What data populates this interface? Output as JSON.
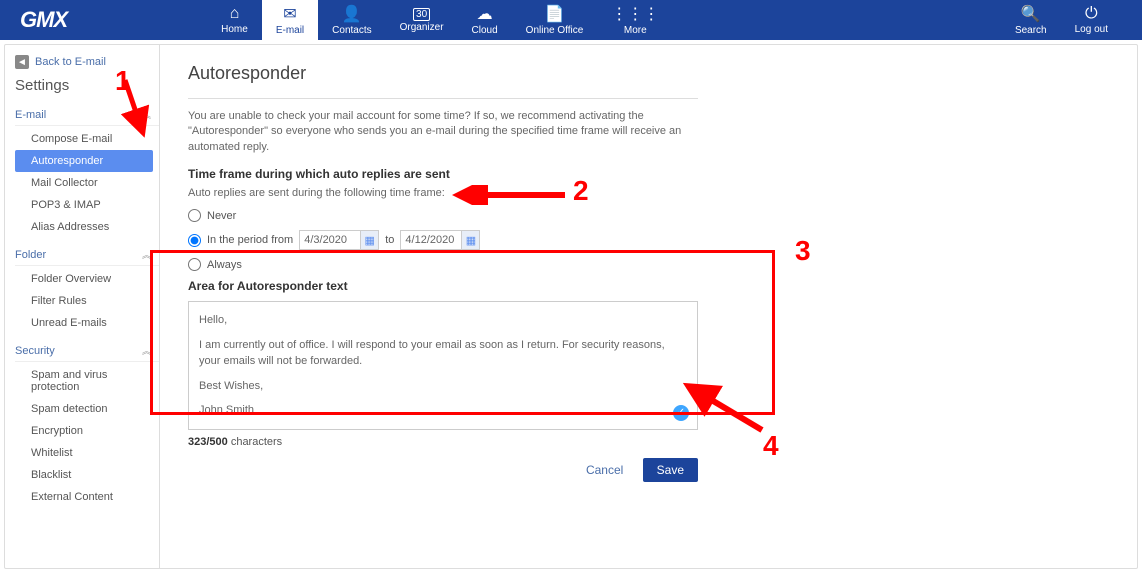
{
  "topnav": {
    "logo": "GMX",
    "items": [
      {
        "label": "Home",
        "icon": "⌂"
      },
      {
        "label": "E-mail",
        "icon": "✉",
        "active": true
      },
      {
        "label": "Contacts",
        "icon": "👤"
      },
      {
        "label": "Organizer",
        "icon": "30"
      },
      {
        "label": "Cloud",
        "icon": "☁"
      },
      {
        "label": "Online Office",
        "icon": "📄"
      },
      {
        "label": "More",
        "icon": "⋮⋮⋮"
      }
    ],
    "right": [
      {
        "label": "Search",
        "icon": "🔍"
      },
      {
        "label": "Log out",
        "icon": "⏻"
      }
    ]
  },
  "sidebar": {
    "back_label": "Back to E-mail",
    "title": "Settings",
    "sections": [
      {
        "title": "E-mail",
        "items": [
          "Compose E-mail",
          "Autoresponder",
          "Mail Collector",
          "POP3 & IMAP",
          "Alias Addresses"
        ],
        "selected": "Autoresponder"
      },
      {
        "title": "Folder",
        "items": [
          "Folder Overview",
          "Filter Rules",
          "Unread E-mails"
        ]
      },
      {
        "title": "Security",
        "items": [
          "Spam and virus protection",
          "Spam detection",
          "Encryption",
          "Whitelist",
          "Blacklist",
          "External Content"
        ]
      }
    ]
  },
  "main": {
    "title": "Autoresponder",
    "intro": "You are unable to check your mail account for some time? If so, we recommend activating the \"Autoresponder\" so everyone who sends you an e-mail during the specified time frame will receive an automated reply.",
    "tf_title": "Time frame during which auto replies are sent",
    "tf_sub": "Auto replies are sent during the following time frame:",
    "radio_never": "Never",
    "radio_period": "In the period from",
    "radio_to": "to",
    "radio_always": "Always",
    "date_from": "4/3/2020",
    "date_to": "4/12/2020",
    "ta_title": "Area for Autoresponder text",
    "ta_body": {
      "l1": "Hello,",
      "l2": "I am currently out of office. I will respond to your email as soon as I return. For security reasons, your emails will not be forwarded.",
      "l3": "Best Wishes,",
      "l4": "John Smith"
    },
    "char_count": "323/500",
    "char_suffix": " characters",
    "cancel": "Cancel",
    "save": "Save"
  },
  "annotations": {
    "n1": "1",
    "n2": "2",
    "n3": "3",
    "n4": "4"
  }
}
